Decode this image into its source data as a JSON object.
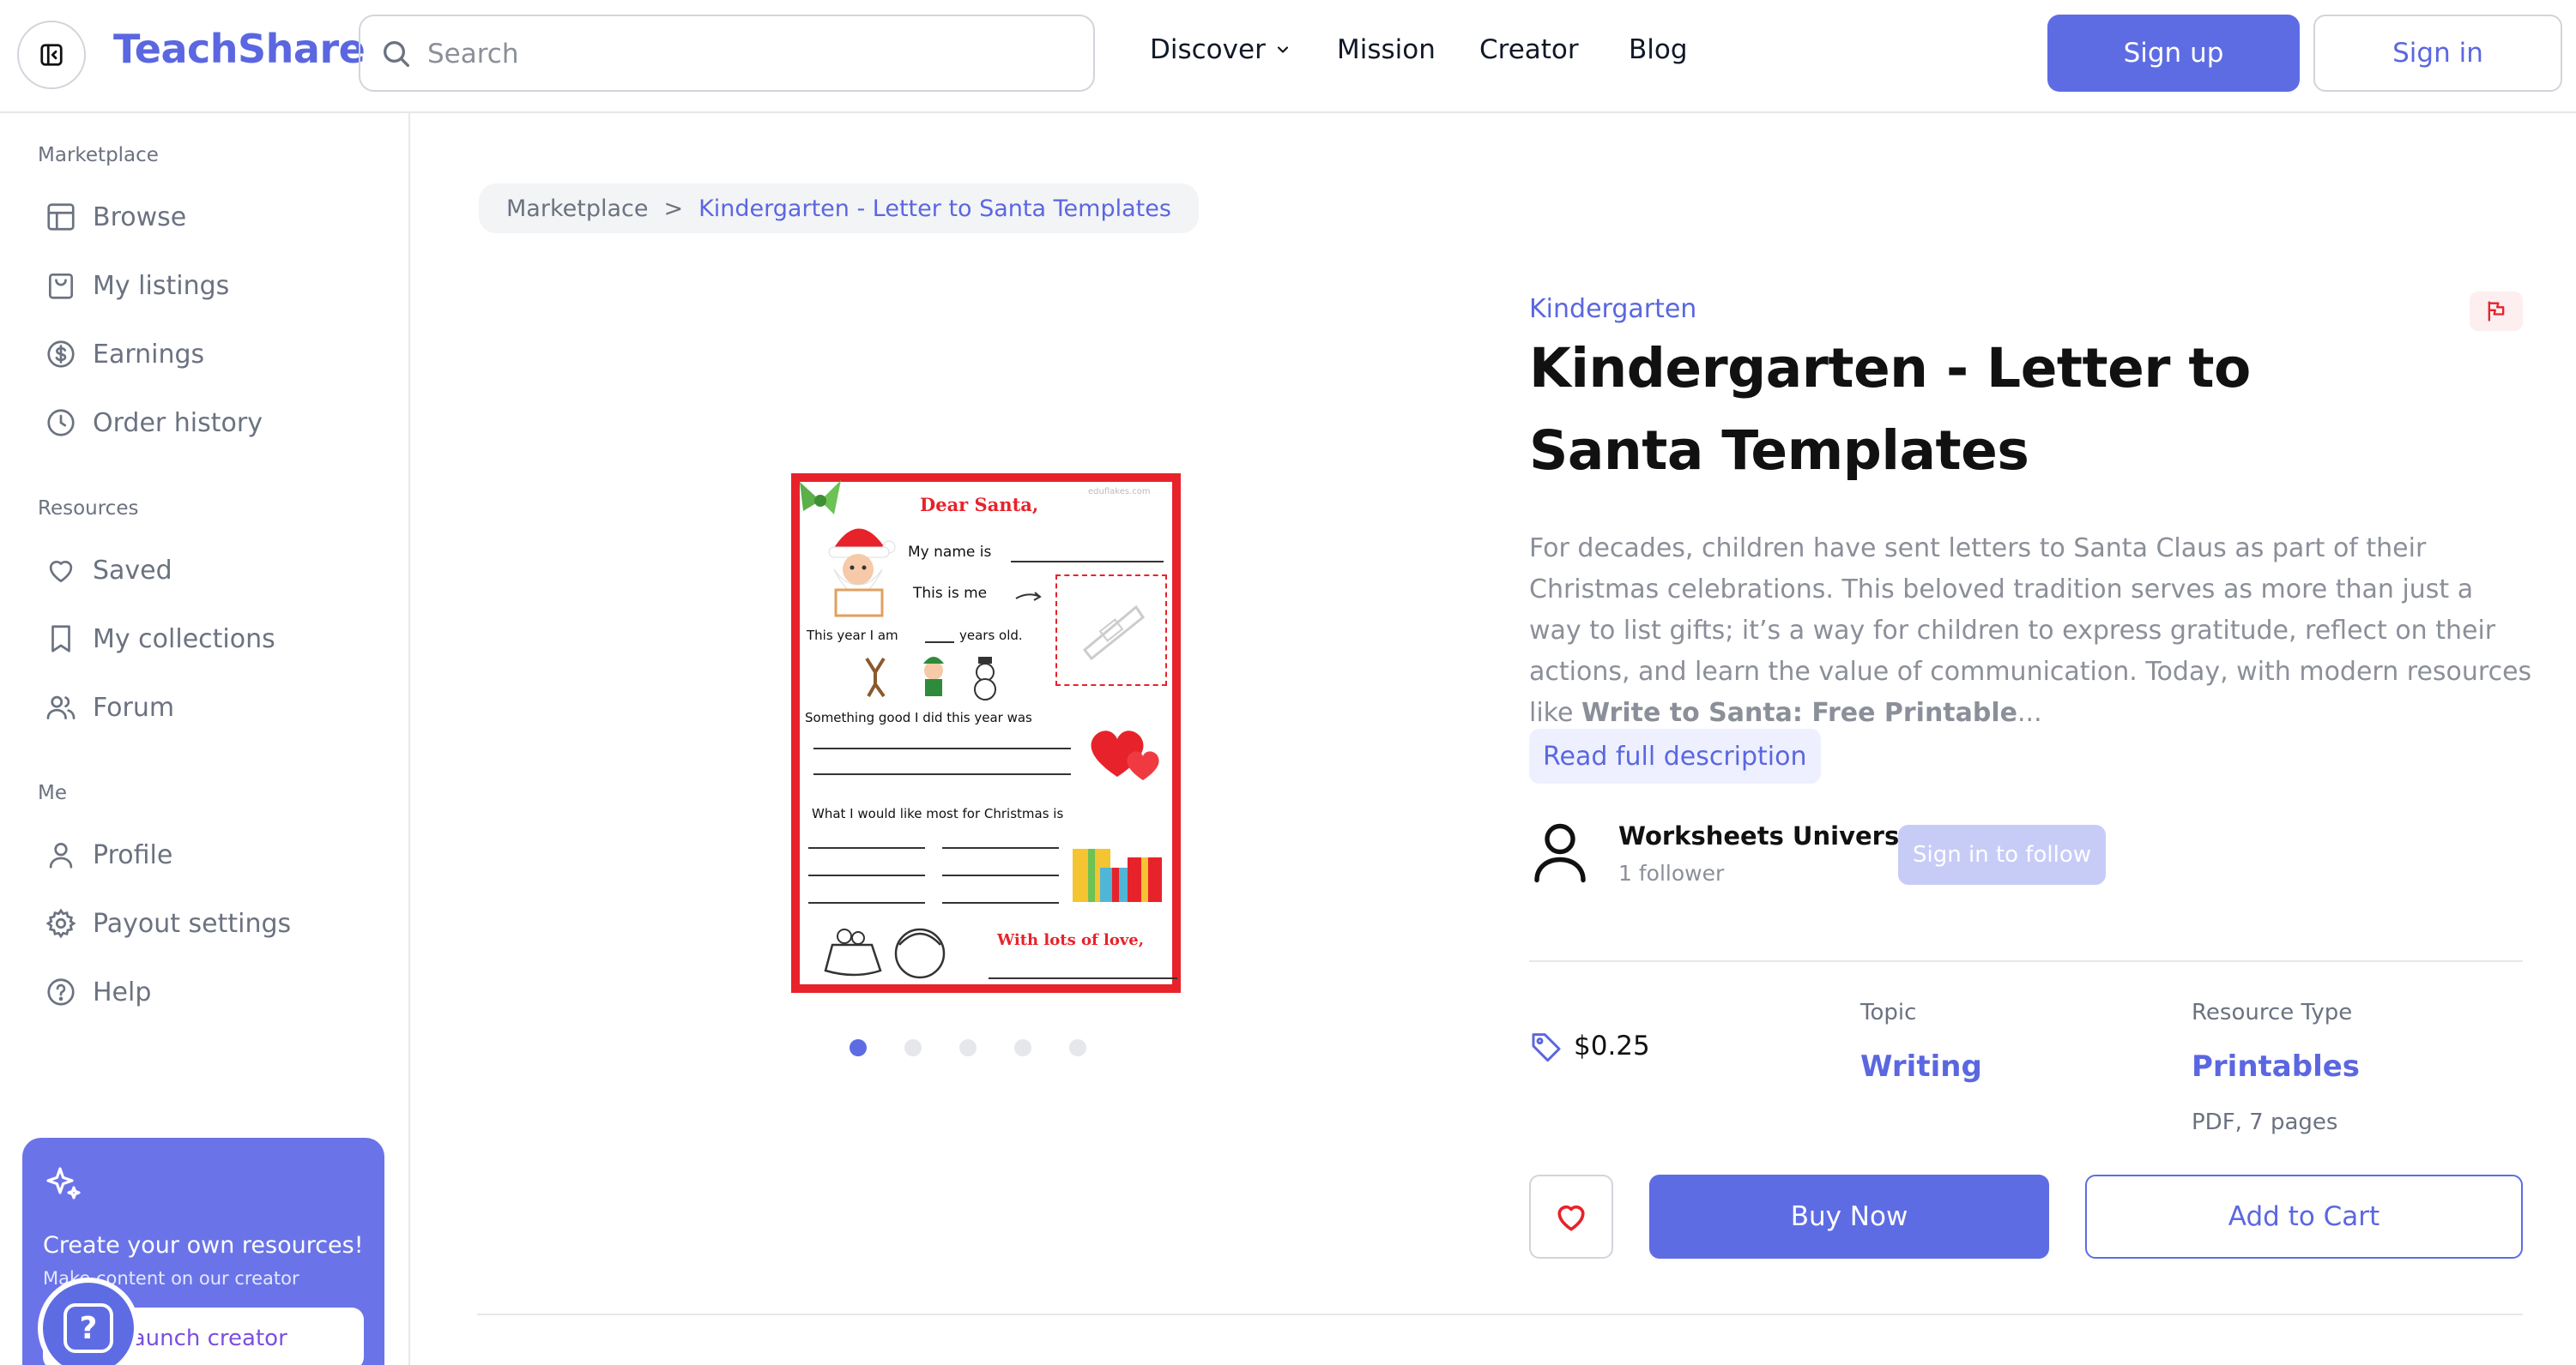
{
  "header": {
    "logo": "TeachShare",
    "search_placeholder": "Search",
    "nav": {
      "discover": "Discover",
      "mission": "Mission",
      "creator": "Creator",
      "blog": "Blog"
    },
    "sign_up": "Sign up",
    "sign_in": "Sign in"
  },
  "sidebar": {
    "sections": [
      {
        "title": "Marketplace",
        "items": [
          {
            "label": "Browse",
            "icon": "browse-icon"
          },
          {
            "label": "My listings",
            "icon": "bag-icon"
          },
          {
            "label": "Earnings",
            "icon": "dollar-icon"
          },
          {
            "label": "Order history",
            "icon": "clock-icon"
          }
        ]
      },
      {
        "title": "Resources",
        "items": [
          {
            "label": "Saved",
            "icon": "heart-icon"
          },
          {
            "label": "My collections",
            "icon": "bookmark-icon"
          },
          {
            "label": "Forum",
            "icon": "users-icon"
          }
        ]
      },
      {
        "title": "Me",
        "items": [
          {
            "label": "Profile",
            "icon": "user-icon"
          },
          {
            "label": "Payout settings",
            "icon": "gear-icon"
          },
          {
            "label": "Help",
            "icon": "question-icon"
          }
        ]
      }
    ],
    "promo": {
      "title": "Create your own resources!",
      "subtitle": "Make content on our creator",
      "button": "Launch creator"
    },
    "help_fab": "?"
  },
  "breadcrumb": {
    "root": "Marketplace",
    "separator": ">",
    "current": "Kindergarten - Letter to Santa Templates"
  },
  "product": {
    "grade": "Kindergarten",
    "title": "Kindergarten - Letter to Santa Templates",
    "description": "For decades, children have sent letters to Santa Claus as part of their Christmas celebrations. This beloved tradition serves as more than just a way to list gifts; it’s a way for children to express gratitude, reflect on their actions, and learn the value of communication. Today, with modern resources like ",
    "description_bold": "Write to Santa: Free Printable",
    "description_ellipsis": "...",
    "read_more": "Read full description",
    "author": {
      "name": "Worksheets Universe",
      "followers": "1 follower",
      "follow_button": "Sign in to follow"
    },
    "price": "$0.25",
    "topic": {
      "label": "Topic",
      "value": "Writing"
    },
    "resource_type": {
      "label": "Resource Type",
      "value": "Printables",
      "detail": "PDF, 7 pages"
    },
    "buy_now": "Buy Now",
    "add_to_cart": "Add to Cart",
    "carousel": {
      "count": 5,
      "active": 0
    }
  },
  "worksheet": {
    "watermark": "eduflakes.com",
    "greeting": "Dear Santa,",
    "name_line": "My name is",
    "this_is_me": "This is me",
    "age_prefix": "This year I am",
    "age_suffix": "years old.",
    "good_thing": "Something good I did this year was",
    "wish": "What I would like most for Christmas is",
    "closing": "With lots of love,"
  },
  "colors": {
    "accent": "#5e6ce4",
    "worksheet_border": "#e8222a"
  }
}
